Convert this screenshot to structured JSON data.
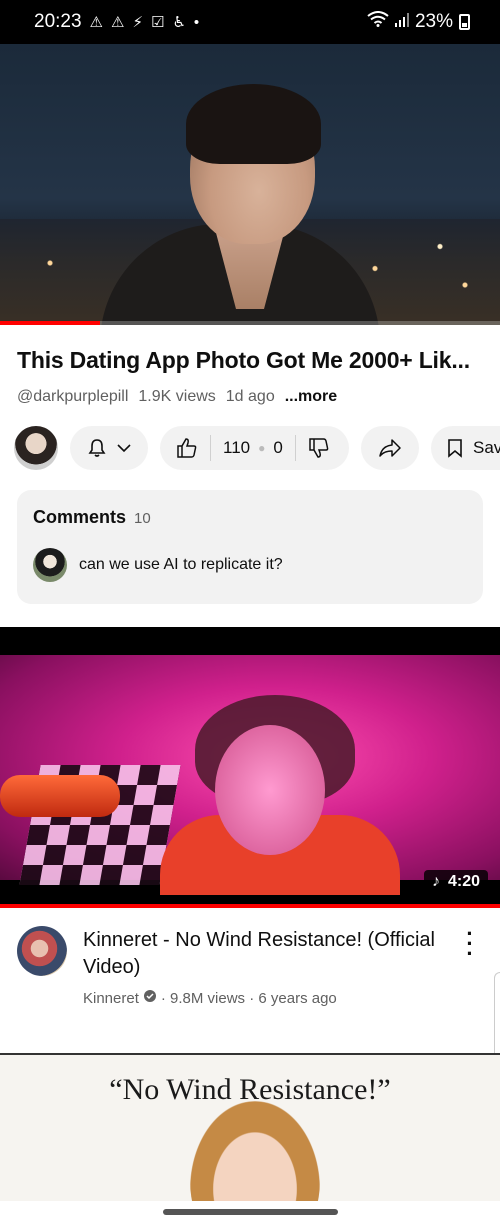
{
  "status_bar": {
    "time": "20:23",
    "icons_left": [
      "warning-icon",
      "warning-icon",
      "flash-icon",
      "mail-check-icon",
      "accessibility-icon",
      "dot-icon"
    ],
    "battery": "23%"
  },
  "video": {
    "title": "This Dating App Photo Got Me 2000+ Lik...",
    "channel": "@darkpurplepill",
    "views": "1.9K views",
    "age": "1d ago",
    "more": "...more",
    "progress": 0.2
  },
  "actions": {
    "likes": "110",
    "dislikes": "0",
    "save": "Save"
  },
  "comments": {
    "label": "Comments",
    "count": "10",
    "top_comment": "can we use AI to replicate it?"
  },
  "next_video": {
    "duration": "4:20",
    "title": "Kinneret - No Wind Resistance! (Official Video)",
    "channel": "Kinneret",
    "views": "· 9.8M views · 6 years ago"
  },
  "third_video": {
    "overlay_text": "“No Wind Resistance!”"
  },
  "colors": {
    "accent": "#ff0000",
    "pill_bg": "#f2f2f2",
    "secondary_text": "#606060"
  }
}
